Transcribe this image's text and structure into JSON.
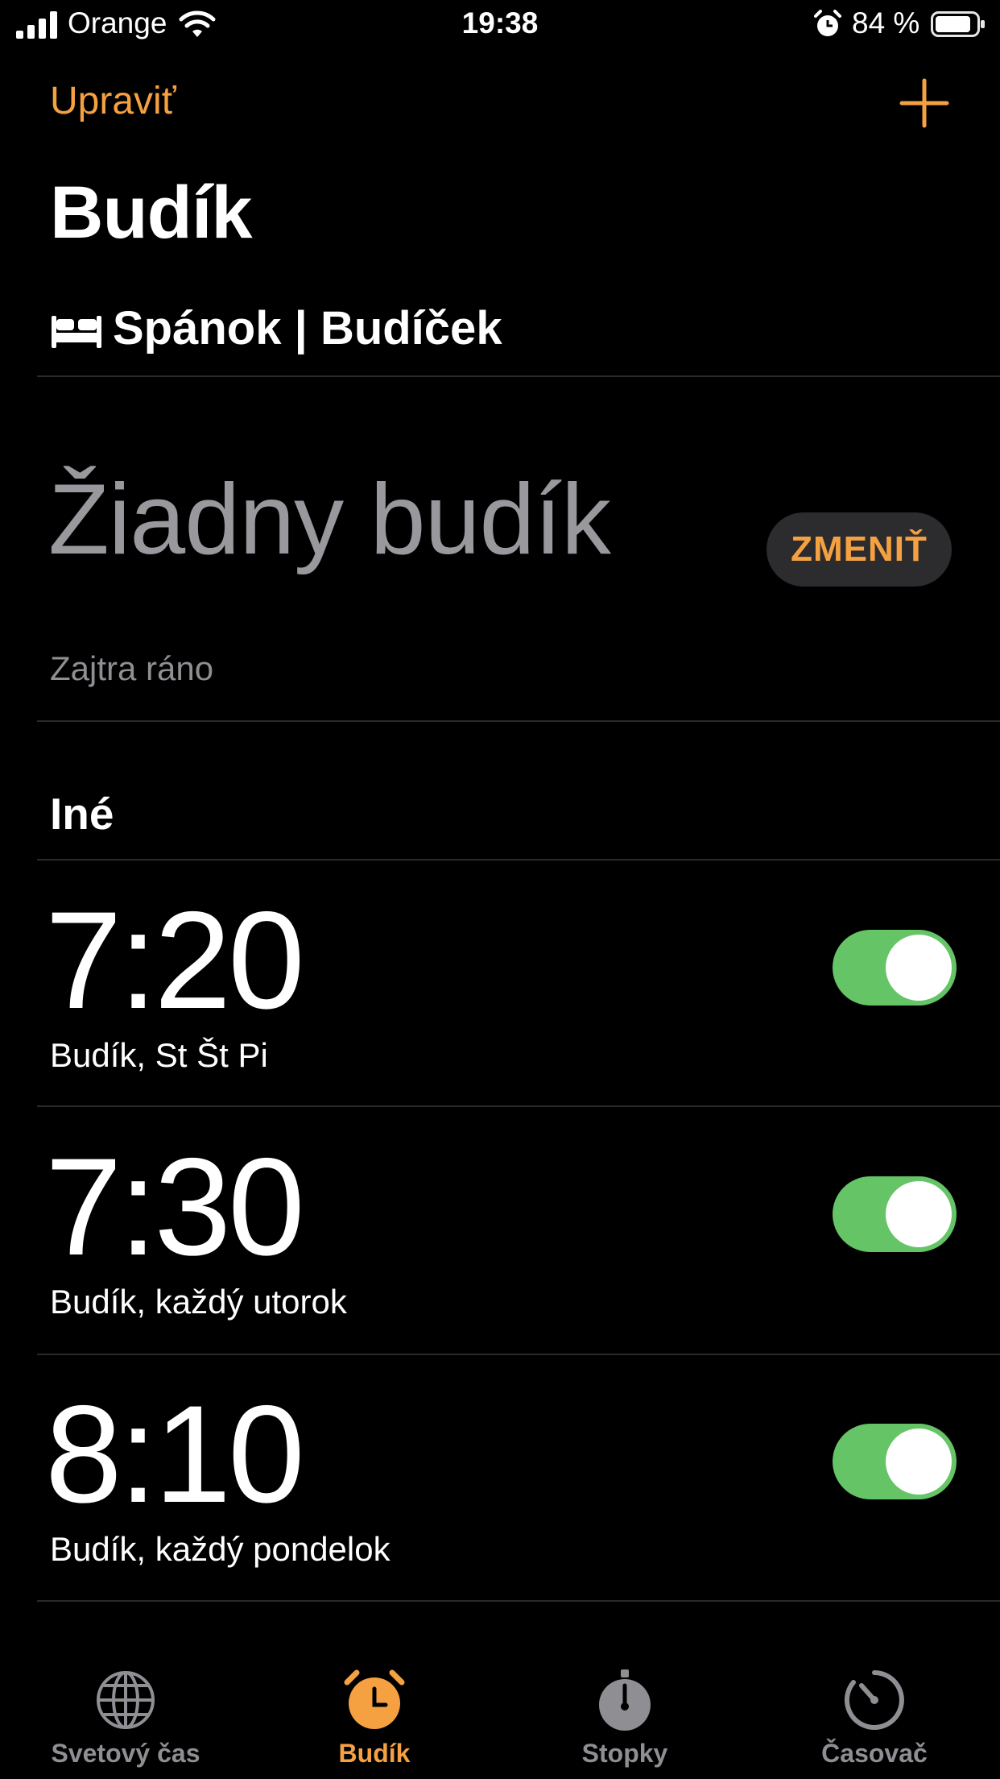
{
  "status_bar": {
    "carrier": "Orange",
    "time": "19:38",
    "battery_percent": "84 %"
  },
  "header": {
    "edit_label": "Upraviť",
    "title": "Budík"
  },
  "sleep": {
    "section_title": "Spánok | Budíček",
    "no_alarm_text": "Žiadny budík",
    "change_label": "ZMENIŤ",
    "subtitle": "Zajtra ráno"
  },
  "other": {
    "section_title": "Iné",
    "alarms": [
      {
        "time": "7:20",
        "label": "Budík, St Št Pi",
        "enabled": true
      },
      {
        "time": "7:30",
        "label": "Budík, každý utorok",
        "enabled": true
      },
      {
        "time": "8:10",
        "label": "Budík, každý pondelok",
        "enabled": true
      }
    ]
  },
  "tab_bar": {
    "tabs": [
      {
        "label": "Svetový čas",
        "icon": "globe-icon",
        "active": false
      },
      {
        "label": "Budík",
        "icon": "alarm-clock-icon",
        "active": true
      },
      {
        "label": "Stopky",
        "icon": "stopwatch-icon",
        "active": false
      },
      {
        "label": "Časovač",
        "icon": "timer-icon",
        "active": false
      }
    ]
  },
  "colors": {
    "accent": "#f5a142",
    "toggle_on": "#65c466",
    "secondary_text": "#8e8e93"
  }
}
